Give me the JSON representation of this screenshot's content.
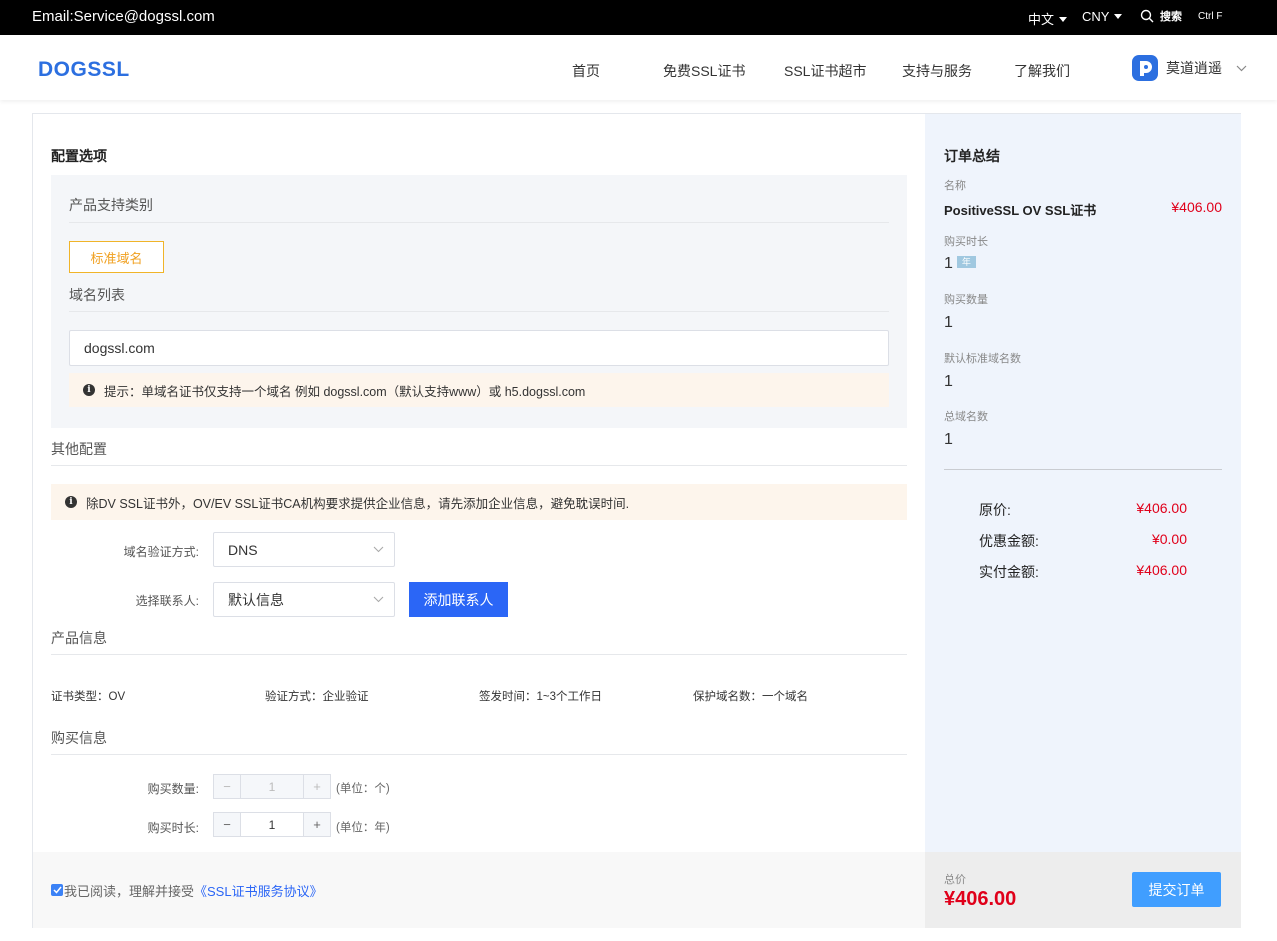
{
  "topbar": {
    "email": "Email:Service@dogssl.com",
    "language": "中文",
    "currency": "CNY",
    "search_label": "搜索",
    "shortcut": "Ctrl F"
  },
  "header": {
    "logo_text": "DOGSSL",
    "nav": [
      "首页",
      "免费SSL证书",
      "SSL证书超市",
      "支持与服务",
      "了解我们"
    ],
    "user_name": "莫道逍遥"
  },
  "config": {
    "title": "配置选项",
    "product_category_label": "产品支持类别",
    "category_tag": "标准域名",
    "domain_list_label": "域名列表",
    "domain_value": "dogssl.com",
    "domain_tip": "提示：单域名证书仅支持一个域名 例如 dogssl.com（默认支持www）或 h5.dogssl.com",
    "other_config_label": "其他配置",
    "company_notice": "除DV SSL证书外，OV/EV SSL证书CA机构要求提供企业信息，请先添加企业信息，避免耽误时间.",
    "verify_method_label": "域名验证方式:",
    "verify_method_value": "DNS",
    "contact_label": "选择联系人:",
    "contact_value": "默认信息",
    "add_contact_button": "添加联系人"
  },
  "product_info": {
    "title": "产品信息",
    "cert_type": "证书类型：OV",
    "verify_type": "验证方式：企业验证",
    "issue_time": "签发时间：1~3个工作日",
    "protected_domains": "保护域名数：一个域名"
  },
  "purchase_info": {
    "title": "购买信息",
    "quantity_label": "购买数量:",
    "quantity_value": "1",
    "quantity_unit": "(单位：个)",
    "duration_label": "购买时长:",
    "duration_value": "1",
    "duration_unit": "(单位：年)",
    "minus": "−",
    "plus": "+"
  },
  "summary": {
    "title": "订单总结",
    "name_label": "名称",
    "product_name": "PositiveSSL OV SSL证书",
    "product_price": "¥406.00",
    "duration_label": "购买时长",
    "duration_value": "1",
    "duration_unit_badge": "年",
    "quantity_label": "购买数量",
    "quantity_value": "1",
    "default_domains_label": "默认标准域名数",
    "default_domains_value": "1",
    "total_domains_label": "总域名数",
    "total_domains_value": "1",
    "original_price_label": "原价:",
    "original_price_value": "¥406.00",
    "discount_label": "优惠金额:",
    "discount_value": "¥0.00",
    "actual_label": "实付金额:",
    "actual_value": "¥406.00"
  },
  "footer": {
    "agree_text": "我已阅读，理解并接受",
    "agreement_link": "《SSL证书服务协议》",
    "total_label": "总价",
    "total_value": "¥406.00",
    "submit_button": "提交订单"
  },
  "colors": {
    "accent_blue": "#2b66f6",
    "price_red": "#e0001a",
    "tag_orange": "#f0a020"
  }
}
